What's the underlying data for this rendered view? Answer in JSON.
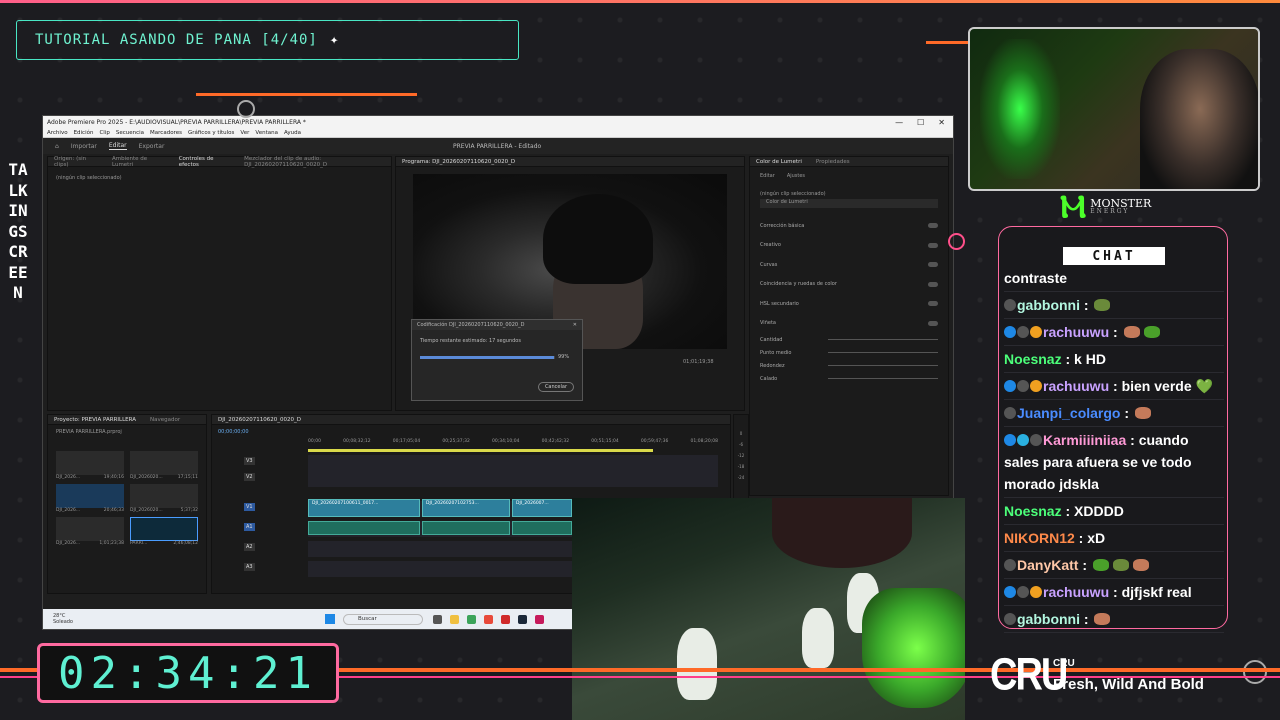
{
  "overlay": {
    "title": "TUTORIAL ASANDO DE PANA [4/40]",
    "vertical_text": "TALKINGSCREEN",
    "timer": "02:34:21",
    "brand": {
      "name": "MONSTER",
      "sub": "ENERGY"
    },
    "now_playing": {
      "logo": "CRU",
      "artist": "CRU",
      "song": "Fresh, Wild And Bold"
    }
  },
  "app": {
    "window_title": "Adobe Premiere Pro 2025 - E:\\AUDIOVISUAL\\PREVIA PARRILLERA\\PREVIA PARRILLERA *",
    "menu": [
      "Archivo",
      "Edición",
      "Clip",
      "Secuencia",
      "Marcadores",
      "Gráficos y títulos",
      "Ver",
      "Ventana",
      "Ayuda"
    ],
    "workspaces": [
      "Importar",
      "Editar",
      "Exportar"
    ],
    "active_workspace": "Editar",
    "project_title": "PREVIA PARRILLERA - Editado",
    "source_tabs": [
      "Origen: (sin clips)",
      "Ambiente de Lumetri",
      "Controles de efectos",
      "Mezclador del clip de audio: DJI_20260207110620_0020_D"
    ],
    "active_source_tab": "Controles de efectos",
    "no_clip": "(ningún clip seleccionado)",
    "program_label": "Programa: DJI_20260207110620_0020_D",
    "program_timecode": "01;01;19;38",
    "lumetri": {
      "tabs": [
        "Color de Lumetri",
        "Propiedades"
      ],
      "subtabs": [
        "Editar",
        "Ajustes"
      ],
      "no_clip": "(ningún clip seleccionado)",
      "look_placeholder": "Color de Lumetri",
      "sections": [
        "Corrección básica",
        "Creativo",
        "Curvas",
        "Coincidencia y ruedas de color",
        "HSL secundario",
        "Viñeta"
      ],
      "vignette_params": [
        "Cantidad",
        "Punto medio",
        "Redondez",
        "Calado"
      ]
    },
    "export_dialog": {
      "title": "Codificación DJI_20260207110620_0020_D",
      "status": "Tiempo restante estimado: 17 segundos",
      "progress": "99%",
      "progress_value": 0.99,
      "cancel": "Cancelar"
    },
    "project_panel": {
      "tabs": [
        "Proyecto: PREVIA PARRILLERA",
        "Navegador"
      ],
      "file": "PREVIA PARRILLERA.prproj",
      "thumbs": [
        {
          "name": "DJI_2026...",
          "dur": "19;40;16"
        },
        {
          "name": "DJI_2026020...",
          "dur": "17;15;11"
        },
        {
          "name": "DJI_2026...",
          "dur": "20;46;33"
        },
        {
          "name": "DJI_2026020...",
          "dur": "5;37;32"
        },
        {
          "name": "DJI_2026...",
          "dur": "1;01;23;38"
        },
        {
          "name": "PARRI...",
          "dur": "2;46;08;12"
        }
      ]
    },
    "timeline": {
      "sequence": "DJI_20260207110620_0020_D",
      "timecode": "00;00;00;00",
      "ruler": [
        "00;00",
        "00;08;32;12",
        "00;17;05;04",
        "00;25;37;32",
        "00;34;10;04",
        "00;42;42;32",
        "00;51;15;04",
        "00;59;47;36",
        "01;08;20;08"
      ],
      "tracks": [
        "V3",
        "V2",
        "V1",
        "A1",
        "A2",
        "A3"
      ],
      "clips": [
        "DJI_20260207100611_0017...",
        "DJI_20260207102753...",
        "DJI_2026007..."
      ],
      "meter_labels": [
        "0",
        "-6",
        "-12",
        "-18",
        "-24"
      ]
    },
    "taskbar": {
      "weather_temp": "28°C",
      "weather_desc": "Soleado",
      "search_placeholder": "Buscar"
    }
  },
  "chat": {
    "title": "CHAT",
    "messages": [
      {
        "user": "",
        "user_color": "#ffffff",
        "text": "contraste",
        "badges": [],
        "emotes": 0
      },
      {
        "user": "gabbonni",
        "user_color": "#b3f7e0",
        "text": "",
        "badges": [
          "mod"
        ],
        "emotes": 1
      },
      {
        "user": "rachuuwu",
        "user_color": "#c9a2ff",
        "text": "",
        "badges": [
          "vip",
          "mod",
          "sub"
        ],
        "emotes": 2
      },
      {
        "user": "Noesnaz",
        "user_color": "#4cff7a",
        "text": "k HD",
        "badges": [],
        "emotes": 0
      },
      {
        "user": "rachuuwu",
        "user_color": "#c9a2ff",
        "text": "bien verde 💚",
        "badges": [
          "vip",
          "mod",
          "sub"
        ],
        "emotes": 0
      },
      {
        "user": "Juanpi_colargo",
        "user_color": "#4a8cff",
        "text": "",
        "badges": [
          "mod"
        ],
        "emotes": 1
      },
      {
        "user": "Karmiiiiniiaa",
        "user_color": "#ff9ad6",
        "text": "cuando sales para afuera se ve todo morado jdskla",
        "badges": [
          "vip",
          "gem",
          "mod"
        ],
        "emotes": 0
      },
      {
        "user": "Noesnaz",
        "user_color": "#4cff7a",
        "text": "XDDDD",
        "badges": [],
        "emotes": 0
      },
      {
        "user": "NIKORN12",
        "user_color": "#ff8a4a",
        "text": "xD",
        "badges": [],
        "emotes": 0
      },
      {
        "user": "DanyKatt",
        "user_color": "#ffc8a8",
        "text": "",
        "badges": [
          "mod"
        ],
        "emotes": 3
      },
      {
        "user": "rachuuwu",
        "user_color": "#c9a2ff",
        "text": "djfjskf real",
        "badges": [
          "vip",
          "mod",
          "sub"
        ],
        "emotes": 0
      },
      {
        "user": "gabbonni",
        "user_color": "#b3f7e0",
        "text": "",
        "badges": [
          "mod"
        ],
        "emotes": 1
      }
    ]
  },
  "colors": {
    "accent_teal": "#49e6c4",
    "accent_pink": "#ff6aa0",
    "accent_orange": "#ff6a28",
    "monster_green": "#4cff2a"
  }
}
